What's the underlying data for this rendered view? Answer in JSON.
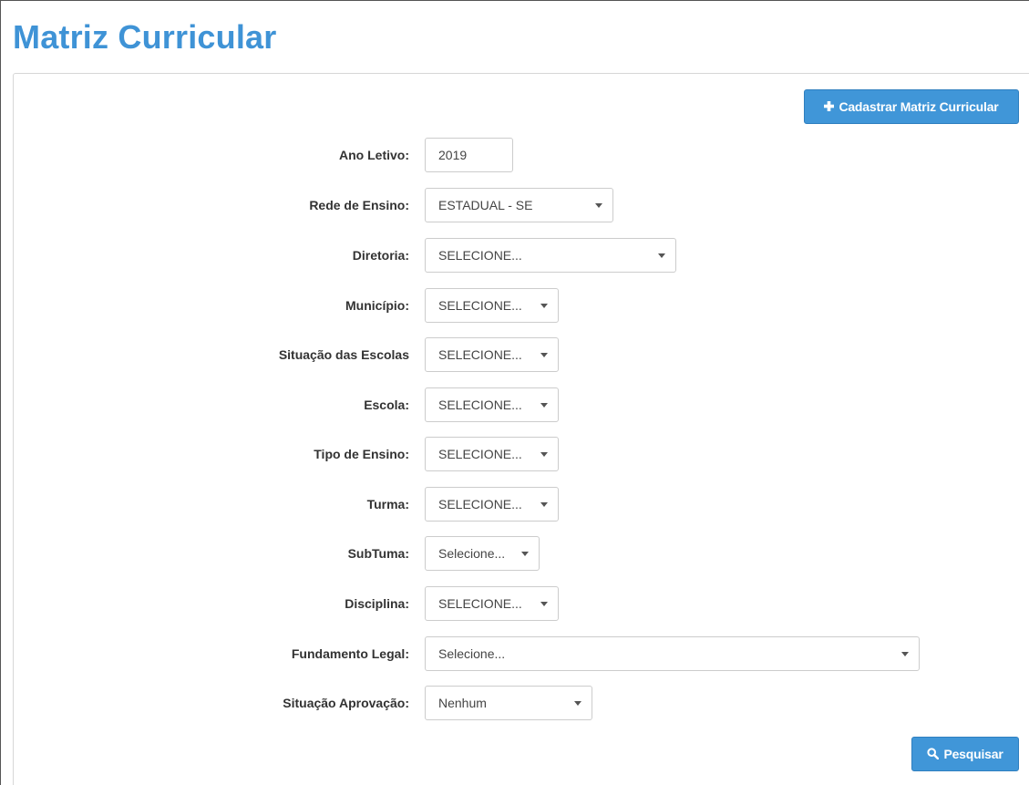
{
  "page": {
    "title": "Matriz Curricular",
    "accent_color": "#3f93d6"
  },
  "actions": {
    "register_label": "Cadastrar Matriz Curricular",
    "register_icon": "plus-icon",
    "search_label": "Pesquisar",
    "search_icon": "search-icon"
  },
  "form": {
    "ano_letivo": {
      "label": "Ano Letivo:",
      "value": "2019"
    },
    "rede_ensino": {
      "label": "Rede de Ensino:",
      "value": "ESTADUAL - SE"
    },
    "diretoria": {
      "label": "Diretoria:",
      "value": "SELECIONE..."
    },
    "municipio": {
      "label": "Município:",
      "value": "SELECIONE..."
    },
    "situacao_escolas": {
      "label": "Situação das Escolas",
      "value": "SELECIONE..."
    },
    "escola": {
      "label": "Escola:",
      "value": "SELECIONE..."
    },
    "tipo_ensino": {
      "label": "Tipo de Ensino:",
      "value": "SELECIONE..."
    },
    "turma": {
      "label": "Turma:",
      "value": "SELECIONE..."
    },
    "subturma": {
      "label": "SubTuma:",
      "value": "Selecione..."
    },
    "disciplina": {
      "label": "Disciplina:",
      "value": "SELECIONE..."
    },
    "fundamento_legal": {
      "label": "Fundamento Legal:",
      "value": "Selecione..."
    },
    "situacao_aprovacao": {
      "label": "Situação Aprovação:",
      "value": "Nenhum"
    }
  }
}
